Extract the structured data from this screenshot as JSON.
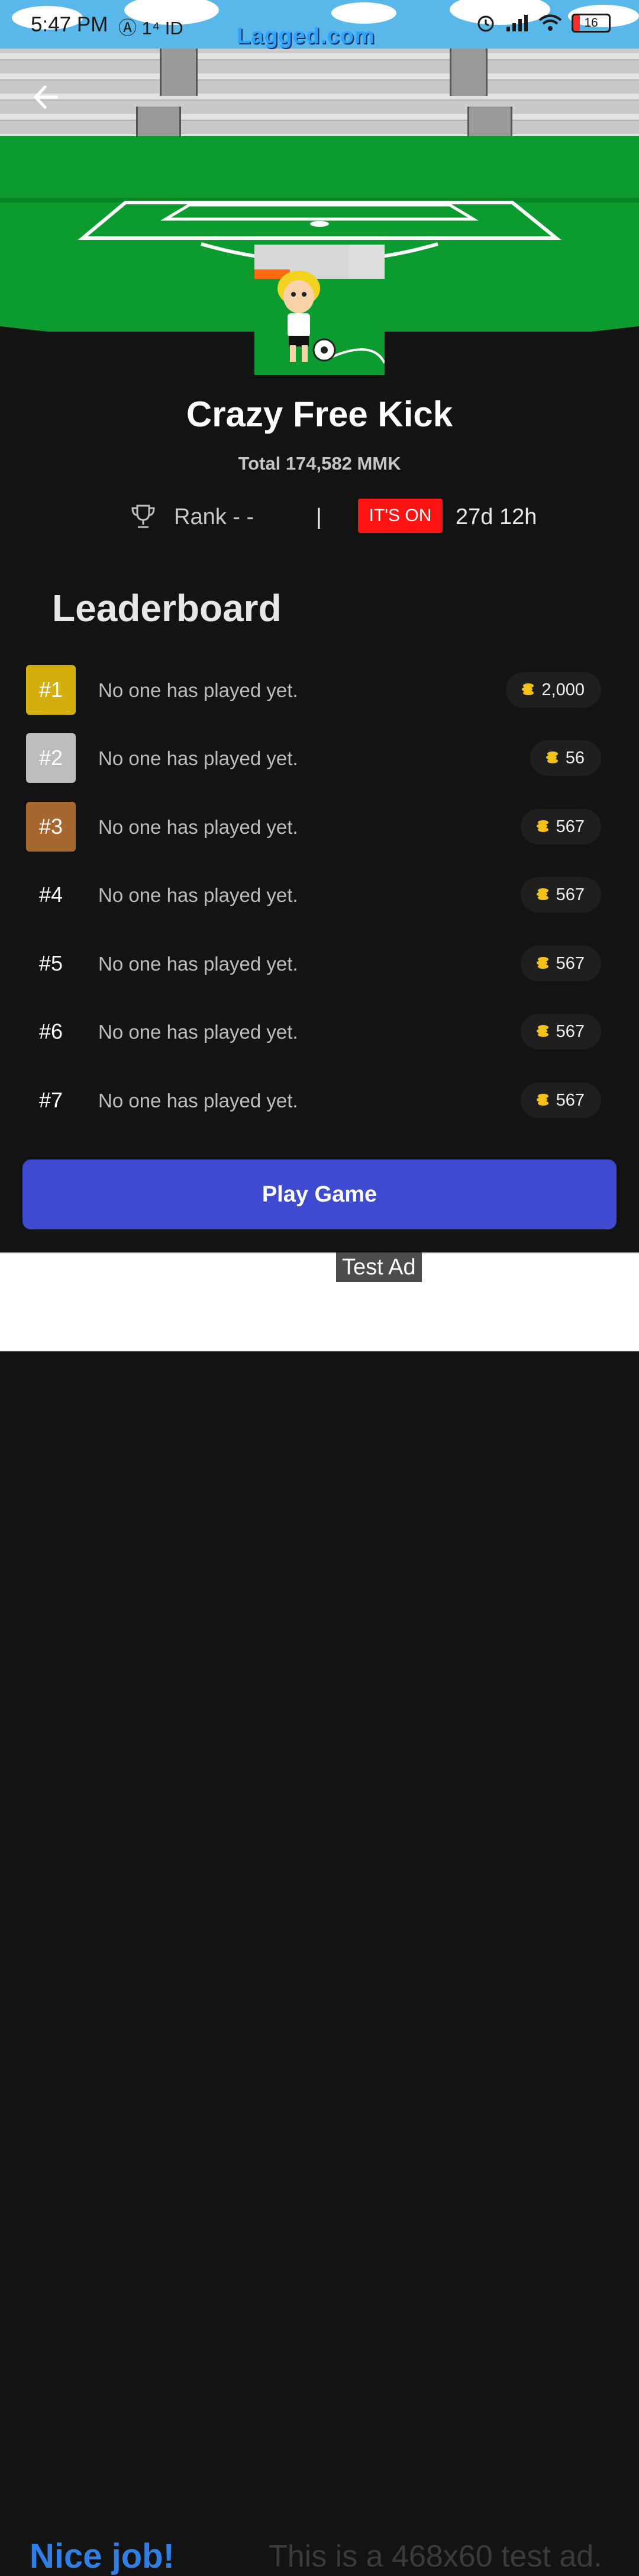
{
  "status_bar": {
    "time": "5:47 PM",
    "left_icons": "Ⓐ 1⁴ ID",
    "battery": "16"
  },
  "hero": {
    "logo": "Lagged.com",
    "back_icon": "arrow-left-icon"
  },
  "game": {
    "title": "Crazy Free Kick",
    "total": "Total 174,582 MMK",
    "rank_label": "Rank - -",
    "divider": "|",
    "status_badge": "IT'S ON",
    "time_left": "27d 12h"
  },
  "leaderboard": {
    "heading": "Leaderboard",
    "rows": [
      {
        "rank": "#1",
        "player": "No one has played yet.",
        "prize": "2,000",
        "badge_color": "#d3ae0d"
      },
      {
        "rank": "#2",
        "player": "No one has played yet.",
        "prize": "56",
        "badge_color": "#bdbdbd"
      },
      {
        "rank": "#3",
        "player": "No one has played yet.",
        "prize": "567",
        "badge_color": "#a8672f"
      },
      {
        "rank": "#4",
        "player": "No one has played yet.",
        "prize": "567",
        "badge_color": ""
      },
      {
        "rank": "#5",
        "player": "No one has played yet.",
        "prize": "567",
        "badge_color": ""
      },
      {
        "rank": "#6",
        "player": "No one has played yet.",
        "prize": "567",
        "badge_color": ""
      },
      {
        "rank": "#7",
        "player": "No one has played yet.",
        "prize": "567",
        "badge_color": ""
      }
    ]
  },
  "actions": {
    "play_label": "Play Game"
  },
  "ad": {
    "tag": "Test Ad",
    "headline": "Nice job!",
    "body": "This is a 468x60 test ad."
  },
  "colors": {
    "accent": "#3e4bd1",
    "live": "#ff1212",
    "pitch": "#0b9b2e",
    "background": "#131313",
    "coin": "#f3c21a"
  }
}
